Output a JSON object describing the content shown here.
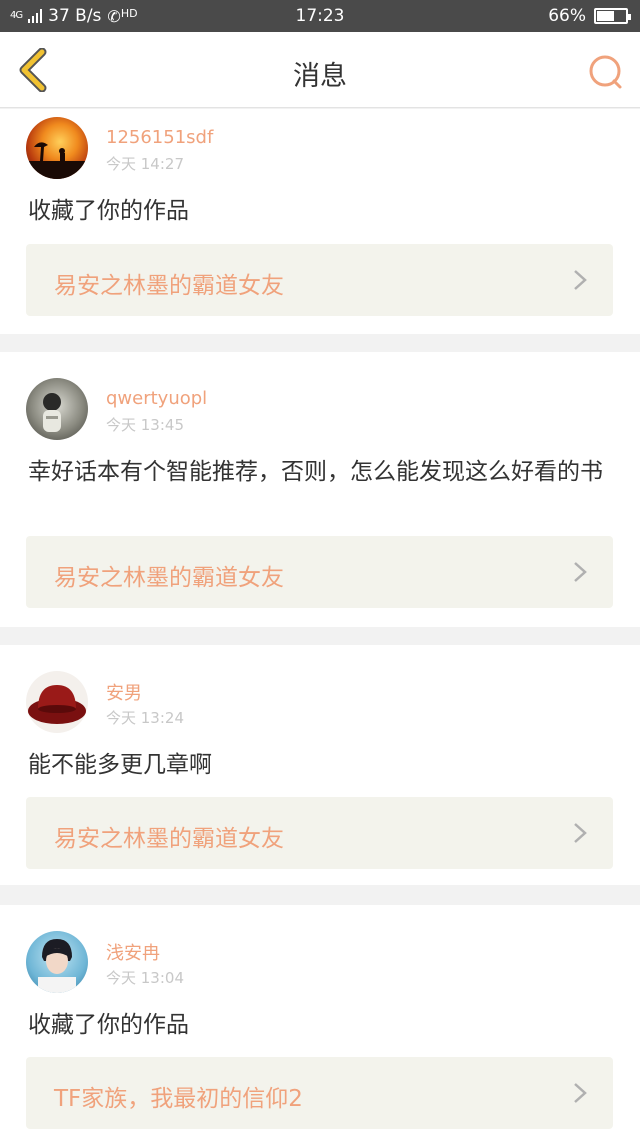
{
  "status_bar": {
    "network": "4G",
    "speed": "37 B/s",
    "call_hd": "HD",
    "time": "17:23",
    "battery": "66%",
    "battery_level": 0.66
  },
  "header": {
    "title": "消息"
  },
  "colors": {
    "accent": "#f0a27c",
    "back_icon": "#f1c232",
    "book_bg": "#f3f3ec"
  },
  "messages": [
    {
      "user": "1256151sdf",
      "time": "今天 14:27",
      "comment": "收藏了你的作品",
      "book": "易安之林墨的霸道女友"
    },
    {
      "user": "qwertyuopl",
      "time": "今天 13:45",
      "comment": "幸好话本有个智能推荐，否则，怎么能发现这么好看的书",
      "book": "易安之林墨的霸道女友"
    },
    {
      "user": "安男",
      "time": "今天 13:24",
      "comment": "能不能多更几章啊",
      "book": "易安之林墨的霸道女友"
    },
    {
      "user": "浅安冉",
      "time": "今天 13:04",
      "comment": "收藏了你的作品",
      "book": "TF家族，我最初的信仰2"
    }
  ]
}
